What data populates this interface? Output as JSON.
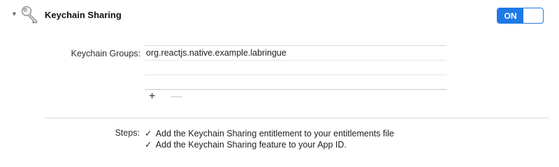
{
  "capability": {
    "title": "Keychain Sharing",
    "toggle_label": "ON",
    "enabled": true,
    "disclosure": "▼"
  },
  "groups": {
    "label": "Keychain Groups:",
    "items": [
      "org.reactjs.native.example.labringue",
      "",
      ""
    ],
    "add_label": "+",
    "remove_label": "—"
  },
  "steps": {
    "label": "Steps:",
    "check_glyph": "✓",
    "items": [
      "Add the Keychain Sharing entitlement to your entitlements file",
      "Add the Keychain Sharing feature to your App ID."
    ]
  },
  "colors": {
    "accent": "#1f7ae6"
  }
}
